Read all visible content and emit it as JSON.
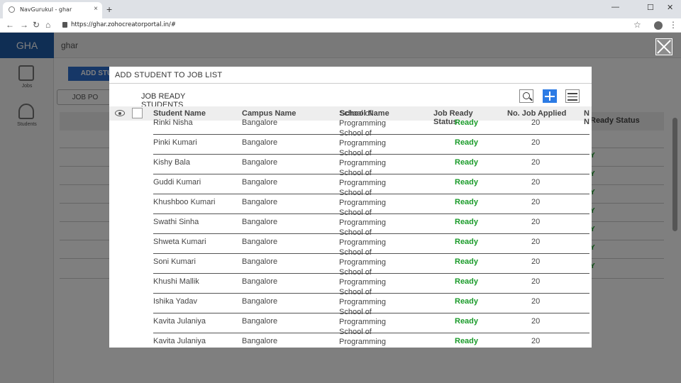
{
  "browser": {
    "tab_title": "NavGurukul - ghar",
    "tab_close": "×",
    "new_tab": "+",
    "url": "https://ghar.zohocreatorportal.in/#",
    "minimize": "—",
    "maximize": "☐",
    "close": "✕"
  },
  "app": {
    "logo": "GHA",
    "name": "ghar",
    "side_item_1": "Jobs",
    "side_item_2": "Students",
    "bg_button": "JOB PO",
    "bg_add_button": "ADD STU",
    "bg_status_header": "Ready Status",
    "bg_status_value": "Y"
  },
  "modal": {
    "title": "ADD STUDENT TO JOB LIST",
    "section_title": "JOB READY STUDENTS",
    "columns": {
      "name": "Student Name",
      "campus": "Campus Name",
      "school": "School Name",
      "ready": "Job Ready Status",
      "applied": "No. Job Applied",
      "extra": "N N"
    },
    "rows": [
      {
        "name": "Rinki Nisha",
        "campus": "Bangalore",
        "school": "School of Programming",
        "ready": "Ready",
        "applied": "20"
      },
      {
        "name": "Pinki Kumari",
        "campus": "Bangalore",
        "school": "School of Programming",
        "ready": "Ready",
        "applied": "20"
      },
      {
        "name": "Kishy Bala",
        "campus": "Bangalore",
        "school": "School of Programming",
        "ready": "Ready",
        "applied": "20"
      },
      {
        "name": "Guddi Kumari",
        "campus": "Bangalore",
        "school": "School of Programming",
        "ready": "Ready",
        "applied": "20"
      },
      {
        "name": "Khushboo Kumari",
        "campus": "Bangalore",
        "school": "School of Programming",
        "ready": "Ready",
        "applied": "20"
      },
      {
        "name": "Swathi Sinha",
        "campus": "Bangalore",
        "school": "School of Programming",
        "ready": "Ready",
        "applied": "20"
      },
      {
        "name": "Shweta Kumari",
        "campus": "Bangalore",
        "school": "School of Programming",
        "ready": "Ready",
        "applied": "20"
      },
      {
        "name": "Soni Kumari",
        "campus": "Bangalore",
        "school": "School of Programming",
        "ready": "Ready",
        "applied": "20"
      },
      {
        "name": "Khushi Mallik",
        "campus": "Bangalore",
        "school": "School of Programming",
        "ready": "Ready",
        "applied": "20"
      },
      {
        "name": "Ishika Yadav",
        "campus": "Bangalore",
        "school": "School of Programming",
        "ready": "Ready",
        "applied": "20"
      },
      {
        "name": "Kavita Julaniya",
        "campus": "Bangalore",
        "school": "School of Programming",
        "ready": "Ready",
        "applied": "20"
      },
      {
        "name": "Kavita Julaniya",
        "campus": "Bangalore",
        "school": "School of Programming",
        "ready": "Ready",
        "applied": "20"
      }
    ]
  },
  "colors": {
    "ready_green": "#1a9b2a",
    "add_blue": "#2c7be5",
    "logo_blue": "#1f5da8"
  }
}
